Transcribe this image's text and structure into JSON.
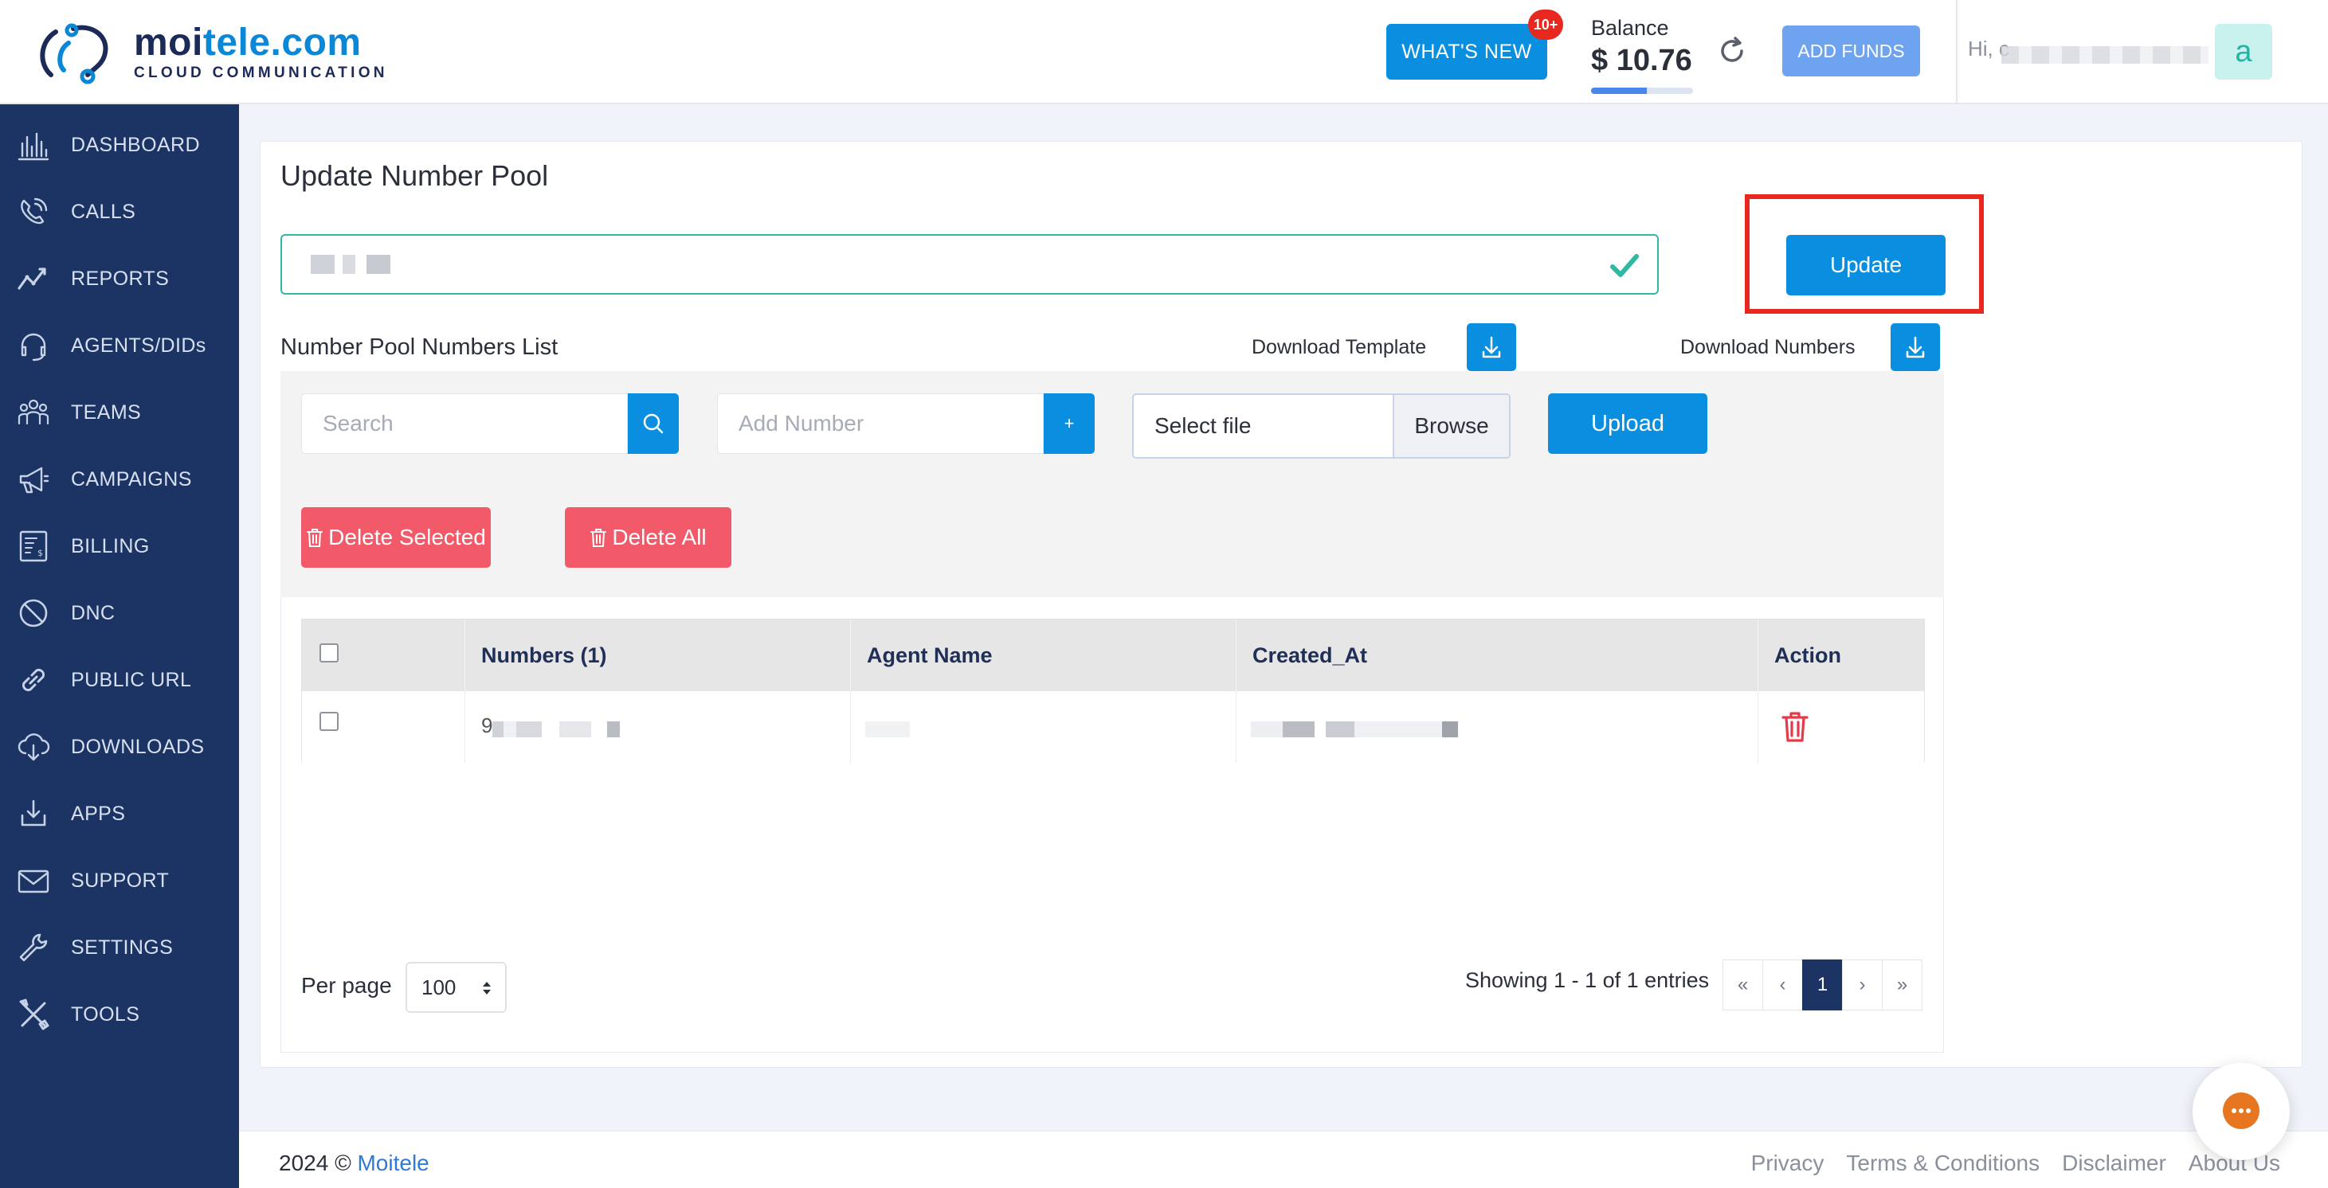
{
  "brand": {
    "name_part1": "moi",
    "name_part2": "tele.com",
    "subtitle": "CLOUD COMMUNICATION"
  },
  "header": {
    "whats_new_label": "WHAT'S NEW",
    "whats_new_badge": "10+",
    "balance_label": "Balance",
    "balance_value": "$ 10.76",
    "add_funds_label": "ADD FUNDS",
    "greeting": "Hi, c",
    "avatar_letter": "a",
    "balance_bar_fraction": 0.55
  },
  "sidebar": {
    "items": [
      {
        "label": "DASHBOARD",
        "icon": "dashboard-icon"
      },
      {
        "label": "CALLS",
        "icon": "calls-icon"
      },
      {
        "label": "REPORTS",
        "icon": "reports-icon"
      },
      {
        "label": "AGENTS/DIDs",
        "icon": "headset-icon"
      },
      {
        "label": "TEAMS",
        "icon": "teams-icon"
      },
      {
        "label": "CAMPAIGNS",
        "icon": "megaphone-icon"
      },
      {
        "label": "BILLING",
        "icon": "billing-icon"
      },
      {
        "label": "DNC",
        "icon": "block-icon"
      },
      {
        "label": "PUBLIC URL",
        "icon": "link-icon"
      },
      {
        "label": "DOWNLOADS",
        "icon": "cloud-download-icon"
      },
      {
        "label": "APPS",
        "icon": "apps-download-icon"
      },
      {
        "label": "SUPPORT",
        "icon": "mail-icon"
      },
      {
        "label": "SETTINGS",
        "icon": "wrench-icon"
      },
      {
        "label": "TOOLS",
        "icon": "tools-icon"
      }
    ]
  },
  "main": {
    "title": "Update Number Pool",
    "update_label": "Update",
    "list_title": "Number Pool Numbers List",
    "download_template_label": "Download Template",
    "download_numbers_label": "Download Numbers",
    "search_placeholder": "Search",
    "add_number_placeholder": "Add Number",
    "add_button_label": "+",
    "select_file_label": "Select file",
    "browse_label": "Browse",
    "upload_label": "Upload",
    "delete_selected_label": "Delete Selected",
    "delete_all_label": "Delete All"
  },
  "table": {
    "columns": [
      "",
      "Numbers (1)",
      "Agent Name",
      "Created_At",
      "Action"
    ],
    "rows": [
      {
        "number": "9"
      }
    ]
  },
  "pagination": {
    "per_page_label": "Per page",
    "per_page_value": "100",
    "showing_text": "Showing 1 - 1 of 1 entries",
    "first": "«",
    "prev": "‹",
    "current": "1",
    "next": "›",
    "last": "»"
  },
  "footer": {
    "copyright_prefix": "2024 © ",
    "copyright_brand": "Moitele",
    "links": [
      "Privacy",
      "Terms & Conditions",
      "Disclaimer",
      "About Us"
    ]
  },
  "colors": {
    "primary": "#0a8fe0",
    "sidebar": "#1c3464",
    "danger": "#f25a6a",
    "success": "#2fb9a3",
    "highlight": "#e8281f"
  }
}
